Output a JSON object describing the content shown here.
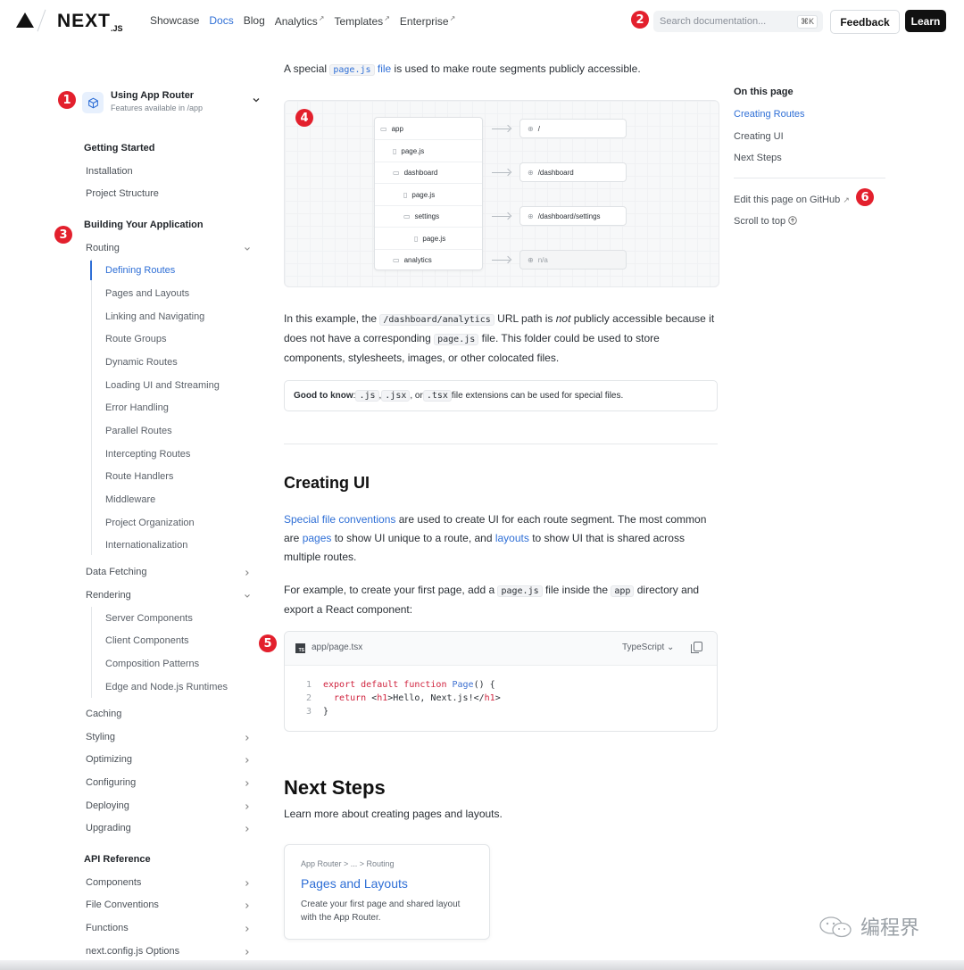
{
  "header": {
    "logo_text": "NEXT",
    "logo_sub": ".JS",
    "nav": [
      {
        "label": "Showcase",
        "external": false,
        "active": false
      },
      {
        "label": "Docs",
        "external": false,
        "active": true
      },
      {
        "label": "Blog",
        "external": false,
        "active": false
      },
      {
        "label": "Analytics",
        "external": true,
        "active": false
      },
      {
        "label": "Templates",
        "external": true,
        "active": false
      },
      {
        "label": "Enterprise",
        "external": true,
        "active": false
      }
    ],
    "external_mark": "↗",
    "search_placeholder": "Search documentation...",
    "search_shortcut": "⌘K",
    "feedback_label": "Feedback",
    "learn_label": "Learn"
  },
  "badges": [
    "1",
    "2",
    "3",
    "4",
    "5",
    "6"
  ],
  "sidebar": {
    "router_title": "Using App Router",
    "router_sub": "Features available in /app",
    "getting_started": "Getting Started",
    "installation": "Installation",
    "project_structure": "Project Structure",
    "building": "Building Your Application",
    "routing": "Routing",
    "routing_items": [
      "Defining Routes",
      "Pages and Layouts",
      "Linking and Navigating",
      "Route Groups",
      "Dynamic Routes",
      "Loading UI and Streaming",
      "Error Handling",
      "Parallel Routes",
      "Intercepting Routes",
      "Route Handlers",
      "Middleware",
      "Project Organization",
      "Internationalization"
    ],
    "data_fetching": "Data Fetching",
    "rendering": "Rendering",
    "rendering_items": [
      "Server Components",
      "Client Components",
      "Composition Patterns",
      "Edge and Node.js Runtimes"
    ],
    "caching": "Caching",
    "more_items": [
      "Styling",
      "Optimizing",
      "Configuring",
      "Deploying",
      "Upgrading"
    ],
    "api_reference": "API Reference",
    "api_items": [
      "Components",
      "File Conventions",
      "Functions",
      "next.config.js Options"
    ]
  },
  "main": {
    "intro_a": "A special ",
    "intro_code": "page.js",
    "intro_link": "file",
    "intro_b": " is used to make route segments publicly accessible.",
    "diagram": {
      "tree": [
        "app",
        "page.js",
        "dashboard",
        "page.js",
        "settings",
        "page.js",
        "analytics"
      ],
      "routes": [
        "/",
        "/dashboard",
        "/dashboard/settings",
        "n/a"
      ]
    },
    "example_a": "In this example, the ",
    "example_code": "/dashboard/analytics",
    "example_b": " URL path is ",
    "example_em": "not",
    "example_c": " publicly accessible because it does not have a corresponding ",
    "example_code2": "page.js",
    "example_d": " file. This folder could be used to store components, stylesheets, images, or other colocated files.",
    "note_bold": "Good to know",
    "note_colon": ": ",
    "note_ext1": ".js",
    "note_comma1": ", ",
    "note_ext2": ".jsx",
    "note_or": ", or ",
    "note_ext3": ".tsx",
    "note_tail": " file extensions can be used for special files.",
    "h_creating": "Creating UI",
    "creating_link1": "Special file conventions",
    "creating_a": " are used to create UI for each route segment. The most common are ",
    "creating_link2": "pages",
    "creating_b": " to show UI unique to a route, and ",
    "creating_link3": "layouts",
    "creating_c": " to show UI that is shared across multiple routes.",
    "first_a": "For example, to create your first page, add a ",
    "first_code": "page.js",
    "first_b": " file inside the ",
    "first_code2": "app",
    "first_c": " directory and export a React component:",
    "code": {
      "ts_badge": "TS",
      "file": "app/page.tsx",
      "lang": "TypeScript",
      "line_numbers": [
        "1",
        "2",
        "3"
      ],
      "l1_kw": "export default function ",
      "l1_fn": "Page",
      "l1_rest": "() {",
      "l2_kw": "  return ",
      "l2_a": "<",
      "l2_tag1": "h1",
      "l2_b": ">Hello, Next.js!</",
      "l2_tag2": "h1",
      "l2_c": ">",
      "l3": "}"
    },
    "h_next": "Next Steps",
    "next_sub": "Learn more about creating pages and layouts.",
    "card": {
      "crumb": "App Router  >  ...  >  Routing",
      "title": "Pages and Layouts",
      "desc": "Create your first page and shared layout with the App Router."
    }
  },
  "toc": {
    "heading": "On this page",
    "items": [
      "Creating Routes",
      "Creating UI",
      "Next Steps"
    ],
    "edit": "Edit this page on GitHub",
    "edit_mark": "↗",
    "scroll": "Scroll to top"
  },
  "watermark": "编程界",
  "colors": {
    "accent": "#2f6fd6",
    "badge": "#e3202d"
  }
}
